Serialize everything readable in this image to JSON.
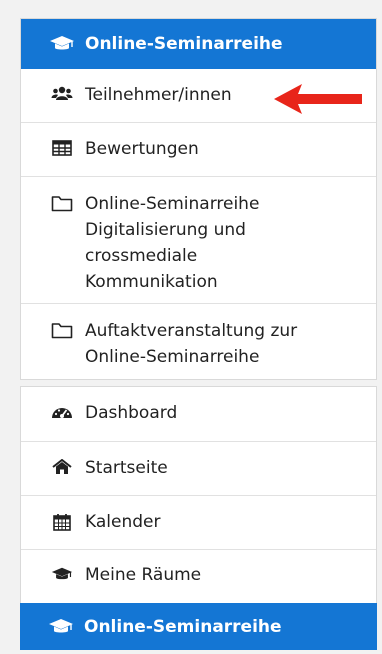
{
  "course_header": {
    "label": "Online-Seminarreihe",
    "icon": "graduation-cap-icon"
  },
  "course_items": [
    {
      "label": "Teilnehmer/innen",
      "icon": "users-icon"
    },
    {
      "label": "Bewertungen",
      "icon": "table-icon"
    },
    {
      "label": "Online-Seminarreihe\nDigitalisierung und\ncrossmediale\nKommunikation",
      "icon": "folder-icon"
    },
    {
      "label": "Auftaktveranstaltung zur\nOnline-Seminarreihe",
      "icon": "folder-icon"
    }
  ],
  "nav_items": [
    {
      "label": "Dashboard",
      "icon": "dashboard-icon"
    },
    {
      "label": "Startseite",
      "icon": "home-icon"
    },
    {
      "label": "Kalender",
      "icon": "calendar-icon"
    },
    {
      "label": "Meine Räume",
      "icon": "graduation-cap-icon"
    }
  ],
  "footer_header": {
    "label": "Online-Seminarreihe",
    "icon": "graduation-cap-icon"
  },
  "colors": {
    "accent": "#1476d4",
    "arrow": "#e8251a"
  }
}
